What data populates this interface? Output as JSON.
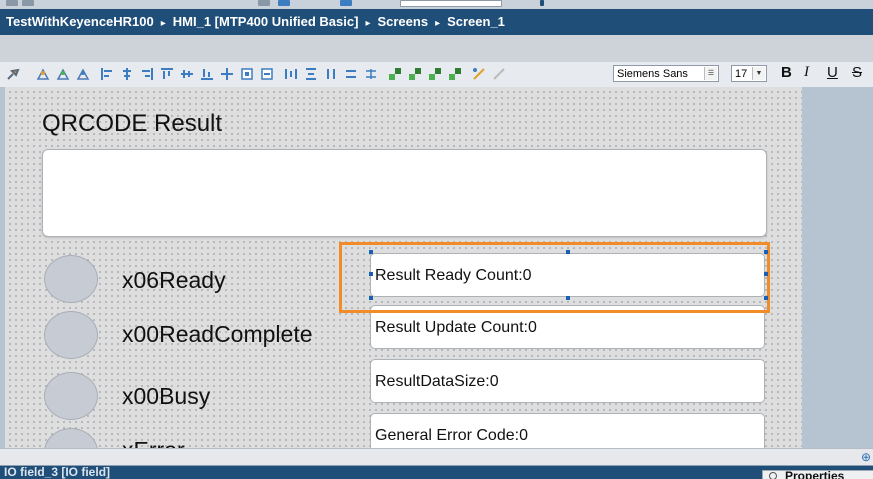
{
  "breadcrumb": {
    "items": [
      "TestWithKeyenceHR100",
      "HMI_1 [MTP400 Unified Basic]",
      "Screens",
      "Screen_1"
    ],
    "separator": "▸"
  },
  "toolbar": {
    "font_name": "Siemens Sans",
    "font_size": "17",
    "bold_label": "B",
    "italic_label": "I",
    "underline_label": "U",
    "strike_label": "S"
  },
  "screen": {
    "title": "QRCODE Result",
    "lamps": [
      {
        "label": "x06Ready"
      },
      {
        "label": "x00ReadComplete"
      },
      {
        "label": "x00Busy"
      },
      {
        "label": "xError"
      }
    ],
    "io_fields": [
      {
        "text": "Result Ready Count:0"
      },
      {
        "text": "Result Update Count:0"
      },
      {
        "text": "ResultDataSize:0"
      },
      {
        "text": "General Error Code:0"
      }
    ],
    "selection_color": "#f28c28"
  },
  "status_bar": {
    "selected_object": "IO field_3 [IO field]",
    "properties_tab": "Properties"
  },
  "colors": {
    "title_bar": "#1f4e79",
    "lamp_fill": "#c7cbd3",
    "selection": "#f28c28"
  }
}
